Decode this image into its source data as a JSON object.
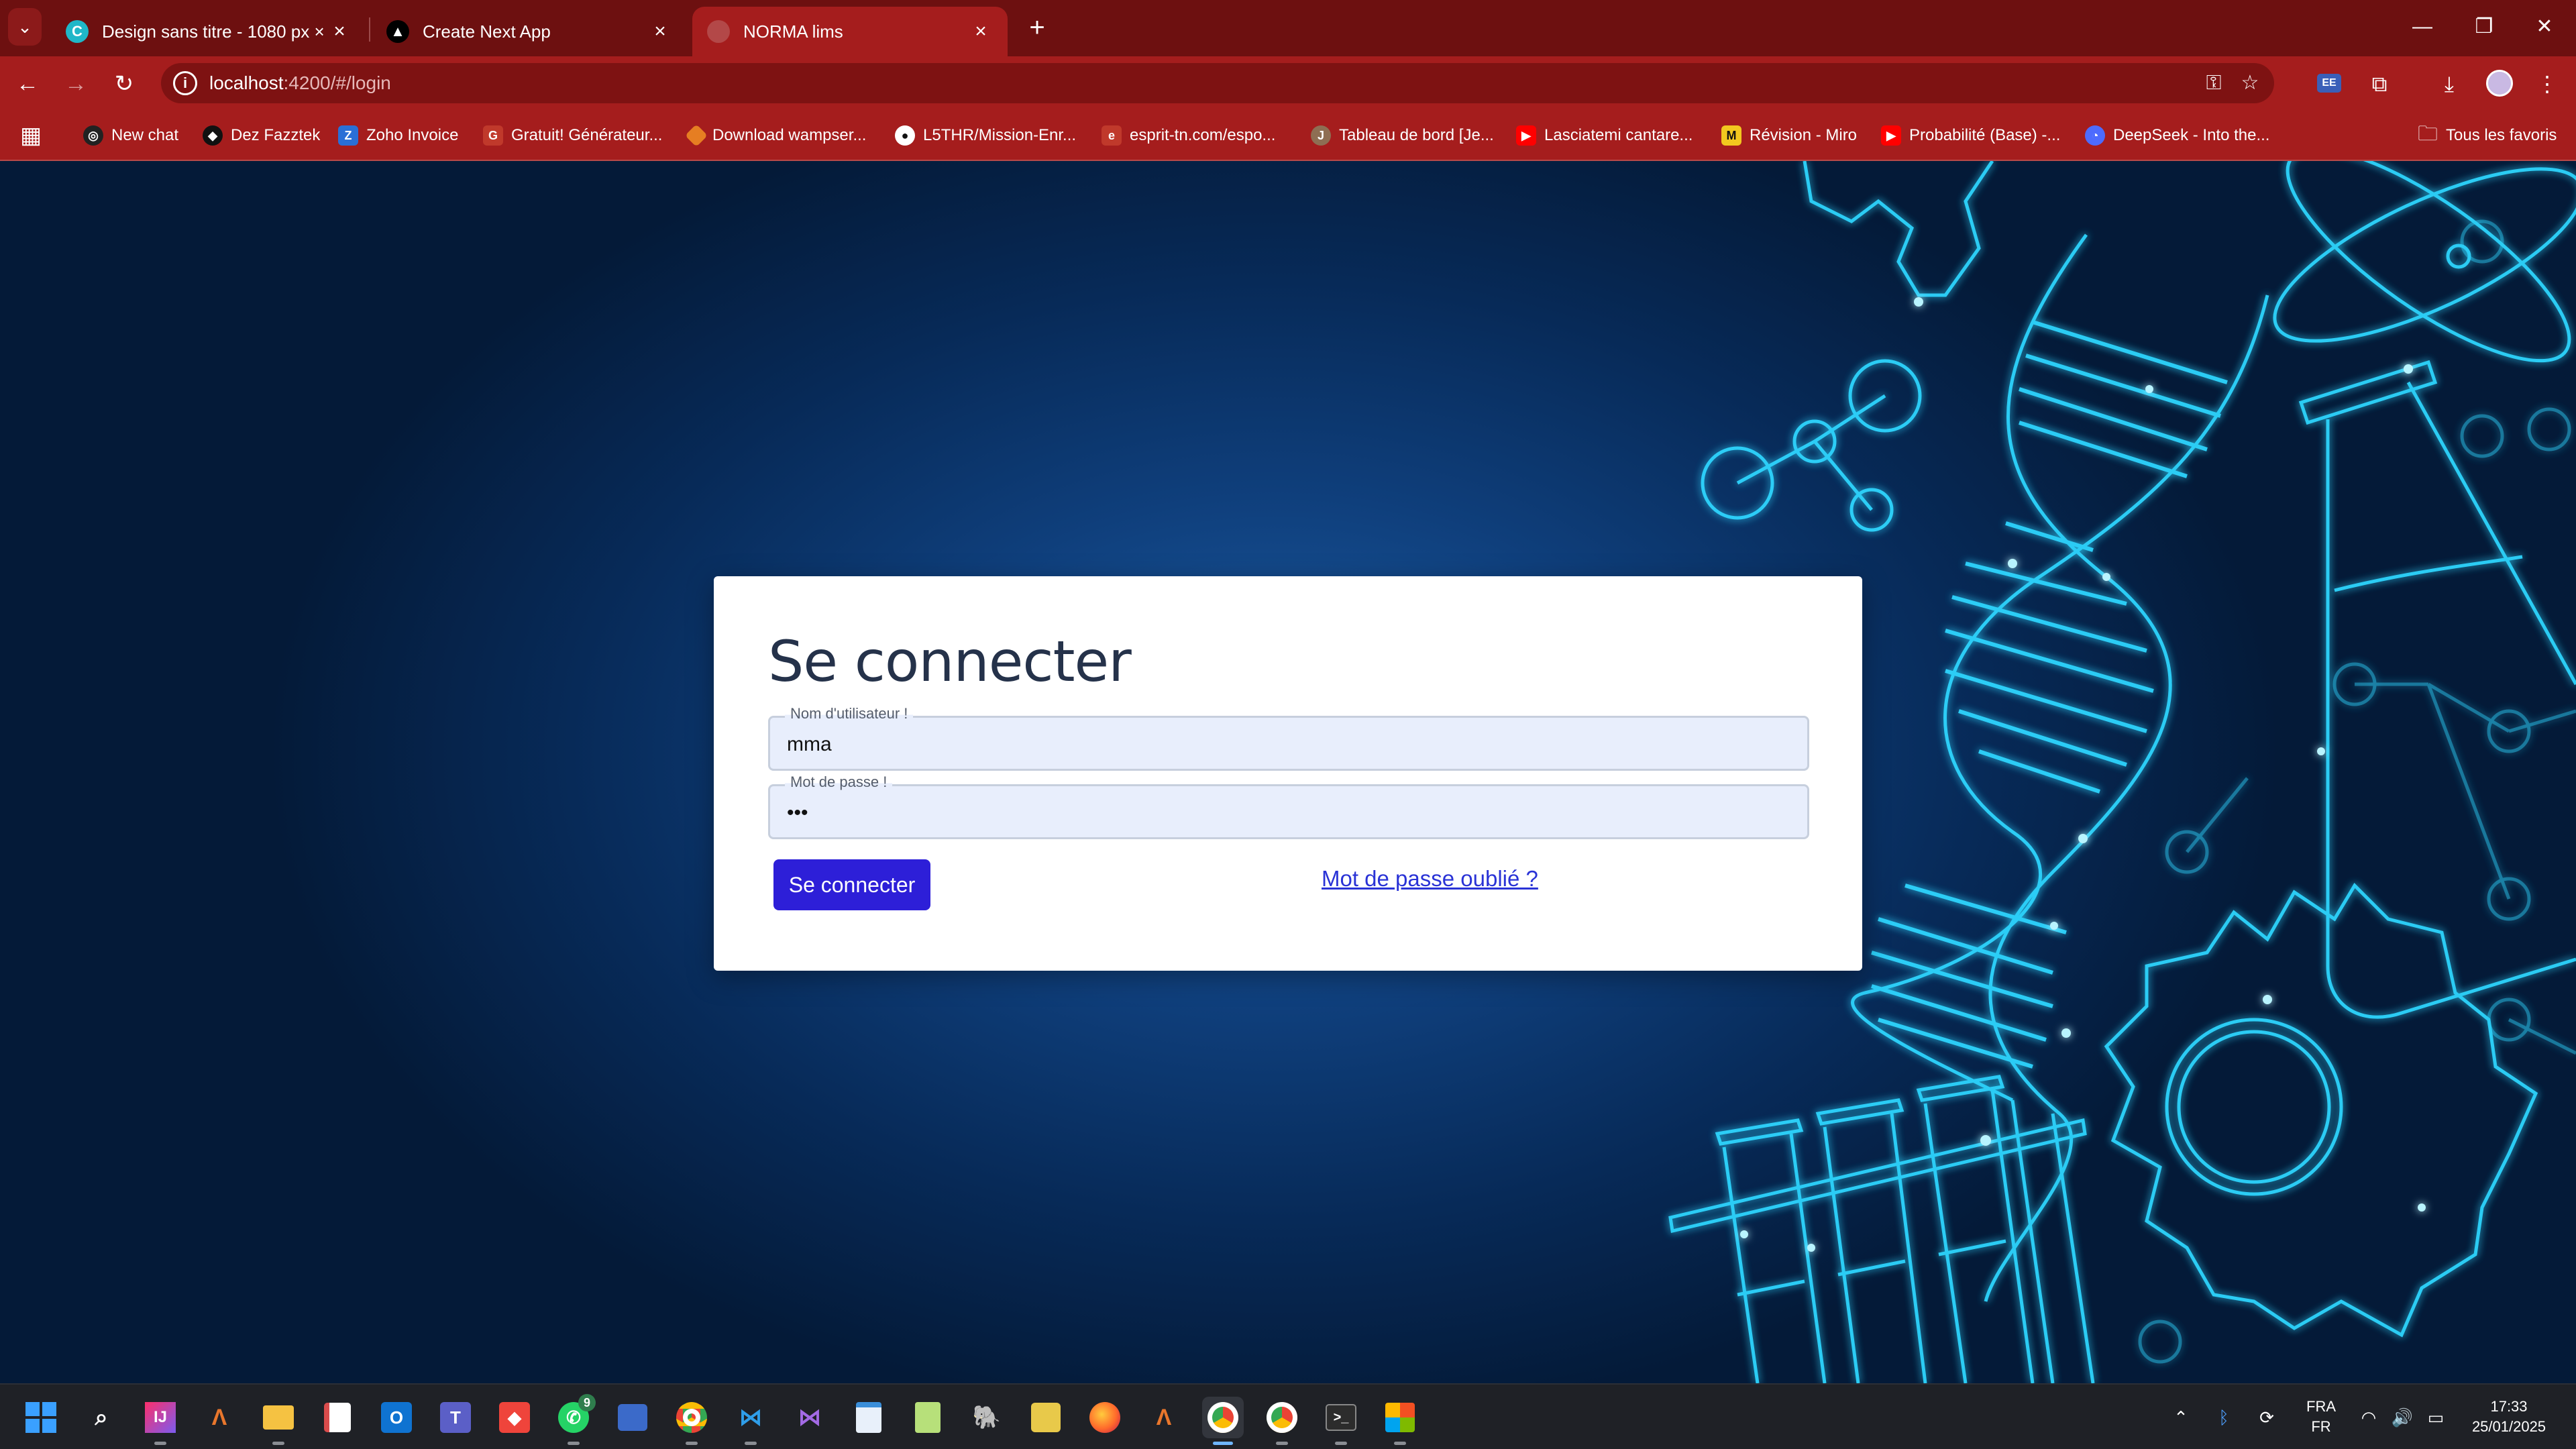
{
  "browser": {
    "tabs": [
      {
        "title": "Design sans titre - 1080 px × 1080 px",
        "favicon": "canva-icon",
        "active": false
      },
      {
        "title": "Create Next App",
        "favicon": "nextjs-icon",
        "active": false
      },
      {
        "title": "NORMA lims",
        "favicon": "page-icon",
        "active": true
      }
    ],
    "url_host": "localhost",
    "url_path": ":4200/#/login",
    "bookmarks": [
      {
        "label": "New chat",
        "icon": "openai-icon",
        "color": "#222222"
      },
      {
        "label": "Dez Fazztek",
        "icon": "fazztek-icon",
        "color": "#111111"
      },
      {
        "label": "Zoho Invoice",
        "icon": "zoho-icon",
        "color": "#2a6fd6"
      },
      {
        "label": "Gratuit! Générateur...",
        "icon": "generator-icon",
        "color": "#c0392b"
      },
      {
        "label": "Download wampser...",
        "icon": "wamp-icon",
        "color": "#e67e22"
      },
      {
        "label": "L5THR/Mission-Enr...",
        "icon": "github-icon",
        "color": "#111111"
      },
      {
        "label": "esprit-tn.com/espo...",
        "icon": "esprit-icon",
        "color": "#c0392b"
      },
      {
        "label": "Tableau de bord [Je...",
        "icon": "dashboard-icon",
        "color": "#8e6e53"
      },
      {
        "label": "Lasciatemi cantare...",
        "icon": "youtube-icon",
        "color": "#ff0000"
      },
      {
        "label": "Révision - Miro",
        "icon": "miro-icon",
        "color": "#f2c81f"
      },
      {
        "label": "Probabilité (Base) -...",
        "icon": "youtube-icon",
        "color": "#ff0000"
      },
      {
        "label": "DeepSeek - Into the...",
        "icon": "deepseek-icon",
        "color": "#4d6bfe"
      }
    ],
    "all_bookmarks_label": "Tous les favoris"
  },
  "login": {
    "title": "Se connecter",
    "username_label": "Nom d'utilisateur !",
    "username_value": "mma",
    "password_label": "Mot de passe !",
    "password_value": "•••",
    "submit_label": "Se connecter",
    "forgot_label": "Mot de passe oublié ?"
  },
  "taskbar": {
    "apps": [
      "start-icon",
      "search-icon",
      "intellij-icon",
      "matlab-icon",
      "file-explorer-icon",
      "snipping-icon",
      "outlook-icon",
      "teams-icon",
      "anydesk-icon",
      "whatsapp-icon",
      "photos-icon",
      "chrome-icon",
      "vscode-icon",
      "visual-studio-icon",
      "notepad-icon",
      "notepad-plus-icon",
      "postgres-icon",
      "pgadmin-icon",
      "firefox-icon",
      "matlab2-icon",
      "chrome-active-icon",
      "chrome-canary-icon",
      "terminal-icon",
      "store-icon"
    ],
    "whatsapp_badge": "9",
    "lang_top": "FRA",
    "lang_bottom": "FR",
    "time": "17:33",
    "date": "25/01/2025"
  },
  "colors": {
    "tabbar": "#6d1010",
    "toolbar": "#a51d1d",
    "accent_button": "#2d1fd8",
    "link": "#2a33d6",
    "neon": "#2fd6ff"
  }
}
